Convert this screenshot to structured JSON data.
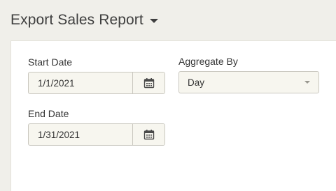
{
  "header": {
    "title": "Export Sales Report"
  },
  "form": {
    "start_date": {
      "label": "Start Date",
      "value": "1/1/2021"
    },
    "end_date": {
      "label": "End Date",
      "value": "1/31/2021"
    },
    "aggregate_by": {
      "label": "Aggregate By",
      "value": "Day"
    }
  },
  "icons": {
    "calendar": "calendar-icon",
    "title_dropdown": "caret-down-icon",
    "select_dropdown": "caret-down-icon"
  },
  "colors": {
    "background": "#f0efea",
    "panel": "#ffffff",
    "field_background": "#f7f6ef",
    "field_border": "#c9c7bf",
    "text": "#333333"
  }
}
